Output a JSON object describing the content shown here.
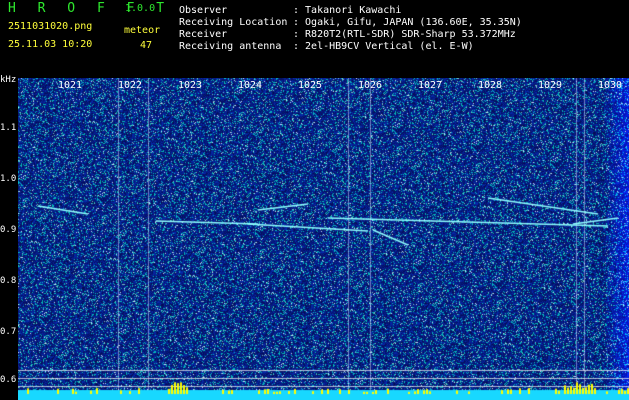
{
  "header": {
    "app_title": "H R O F F T",
    "app_version": "1.0.0",
    "file_name": "2511031020.png",
    "date_time": "25.11.03 10:20",
    "meteor_label": "meteor",
    "meteor_count": "47"
  },
  "info": [
    {
      "key": "Observer",
      "value": ": Takanori Kawachi"
    },
    {
      "key": "Receiving Location",
      "value": ": Ogaki, Gifu, JAPAN (136.60E, 35.35N)"
    },
    {
      "key": "Receiver",
      "value": ": R820T2(RTL-SDR) SDR-Sharp 53.372MHz"
    },
    {
      "key": "Receiving antenna",
      "value": ": 2el-HB9CV Vertical (el. E-W)"
    }
  ],
  "axis": {
    "unit": "kHz",
    "ticks": [
      {
        "label": "1.1",
        "value": 1.1
      },
      {
        "label": "1.0",
        "value": 1.0
      },
      {
        "label": "0.9",
        "value": 0.9
      },
      {
        "label": "0.8",
        "value": 0.8
      },
      {
        "label": "0.7",
        "value": 0.7
      },
      {
        "label": "0.6",
        "value": 0.6
      }
    ]
  },
  "minutes": [
    "1021",
    "1022",
    "1023",
    "1024",
    "1025",
    "1026",
    "1027",
    "1028",
    "1029",
    "1030"
  ],
  "colors": {
    "background": "#000000",
    "noise_low": "#06106e",
    "noise_high": "#3a6cff",
    "signal": "#7fffff",
    "power_bar": "#18d8ff",
    "power_peak": "#ffff00",
    "text_green": "#2ee82e",
    "text_yellow": "#ffff3a",
    "text_white": "#ffffff"
  }
}
